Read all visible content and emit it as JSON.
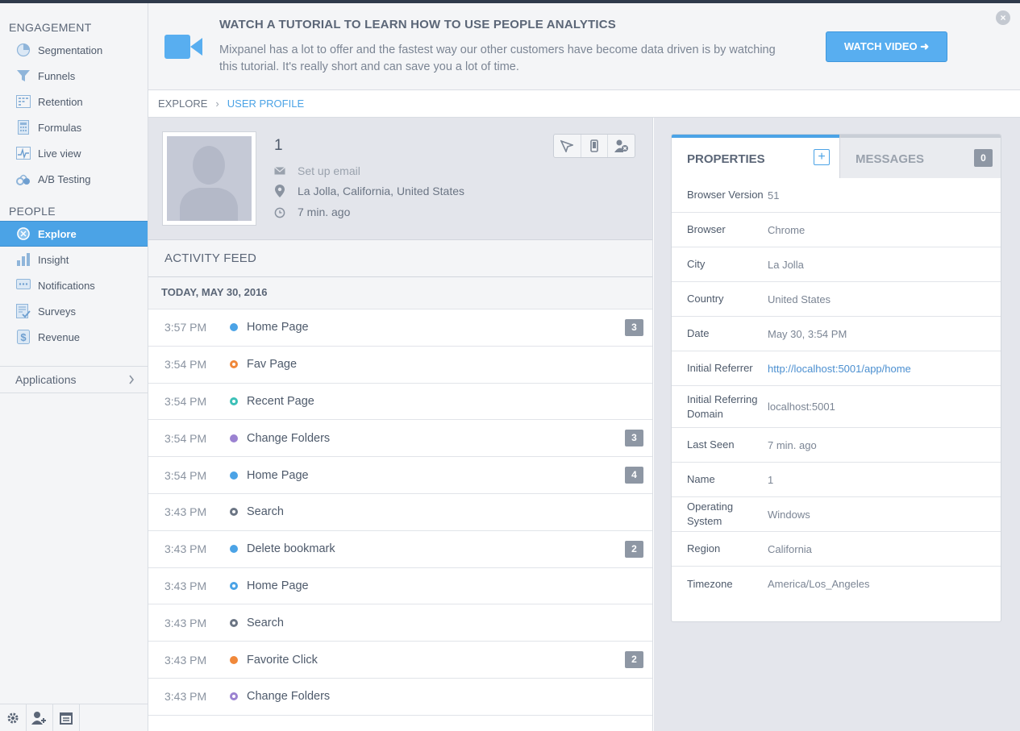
{
  "sidebar": {
    "engagement_heading": "ENGAGEMENT",
    "engagement_items": [
      {
        "label": "Segmentation",
        "icon": "pie-chart-icon"
      },
      {
        "label": "Funnels",
        "icon": "funnel-icon"
      },
      {
        "label": "Retention",
        "icon": "retention-grid-icon"
      },
      {
        "label": "Formulas",
        "icon": "calculator-icon"
      },
      {
        "label": "Live view",
        "icon": "live-view-icon"
      },
      {
        "label": "A/B Testing",
        "icon": "ab-testing-icon"
      }
    ],
    "people_heading": "PEOPLE",
    "people_items": [
      {
        "label": "Explore",
        "icon": "explore-icon",
        "active": true
      },
      {
        "label": "Insight",
        "icon": "bar-chart-icon"
      },
      {
        "label": "Notifications",
        "icon": "chat-bubble-icon"
      },
      {
        "label": "Surveys",
        "icon": "checklist-icon"
      },
      {
        "label": "Revenue",
        "icon": "dollar-icon"
      }
    ],
    "applications_label": "Applications",
    "footer_icons": [
      "gear-icon",
      "add-user-icon",
      "calendar-icon"
    ]
  },
  "banner": {
    "title": "WATCH A TUTORIAL TO LEARN HOW TO USE PEOPLE ANALYTICS",
    "body": "Mixpanel has a lot to offer and the fastest way our other customers have become data driven is by watching this tutorial. It's really short and can save you a lot of time.",
    "button_label": "WATCH VIDEO ➜",
    "close": "×"
  },
  "breadcrumb": {
    "root": "EXPLORE",
    "separator": "›",
    "current": "USER PROFILE"
  },
  "profile": {
    "name": "1",
    "email_placeholder": "Set up email",
    "location": "La Jolla, California, United States",
    "last_seen": "7 min. ago"
  },
  "activity": {
    "heading": "ACTIVITY FEED",
    "day": "TODAY, MAY 30, 2016",
    "events": [
      {
        "time": "3:57 PM",
        "name": "Home Page",
        "color": "#4ba3e6",
        "ring": false,
        "count": "3"
      },
      {
        "time": "3:54 PM",
        "name": "Fav Page",
        "color": "#f0883a",
        "ring": true,
        "count": ""
      },
      {
        "time": "3:54 PM",
        "name": "Recent Page",
        "color": "#3cc0b7",
        "ring": true,
        "count": ""
      },
      {
        "time": "3:54 PM",
        "name": "Change Folders",
        "color": "#9b82d1",
        "ring": false,
        "count": "3"
      },
      {
        "time": "3:54 PM",
        "name": "Home Page",
        "color": "#4ba3e6",
        "ring": false,
        "count": "4"
      },
      {
        "time": "3:43 PM",
        "name": "Search",
        "color": "#6b7584",
        "ring": true,
        "count": ""
      },
      {
        "time": "3:43 PM",
        "name": "Delete bookmark",
        "color": "#4ba3e6",
        "ring": false,
        "count": "2"
      },
      {
        "time": "3:43 PM",
        "name": "Home Page",
        "color": "#4ba3e6",
        "ring": true,
        "count": ""
      },
      {
        "time": "3:43 PM",
        "name": "Search",
        "color": "#6b7584",
        "ring": true,
        "count": ""
      },
      {
        "time": "3:43 PM",
        "name": "Favorite Click",
        "color": "#f0883a",
        "ring": false,
        "count": "2"
      },
      {
        "time": "3:43 PM",
        "name": "Change Folders",
        "color": "#9b82d1",
        "ring": true,
        "count": ""
      }
    ]
  },
  "properties": {
    "tab_properties": "PROPERTIES",
    "tab_add": "+",
    "tab_messages": "MESSAGES",
    "messages_count": "0",
    "rows": [
      {
        "key": "Browser Version",
        "value": "51",
        "link": false
      },
      {
        "key": "Browser",
        "value": "Chrome",
        "link": false
      },
      {
        "key": "City",
        "value": "La Jolla",
        "link": false
      },
      {
        "key": "Country",
        "value": "United States",
        "link": false
      },
      {
        "key": "Date",
        "value": "May 30, 3:54 PM",
        "link": false
      },
      {
        "key": "Initial Referrer",
        "value": "http://localhost:5001/app/home",
        "link": true
      },
      {
        "key": "Initial Referring Domain",
        "value": "localhost:5001",
        "link": false
      },
      {
        "key": "Last Seen",
        "value": "7 min. ago",
        "link": false
      },
      {
        "key": "Name",
        "value": "1",
        "link": false
      },
      {
        "key": "Operating System",
        "value": "Windows",
        "link": false
      },
      {
        "key": "Region",
        "value": "California",
        "link": false
      },
      {
        "key": "Timezone",
        "value": "America/Los_Angeles",
        "link": false
      }
    ]
  },
  "colors": {
    "accent": "#4ba3e6",
    "sidebar_bg": "#f4f5f7",
    "badge": "#8e97a4"
  }
}
